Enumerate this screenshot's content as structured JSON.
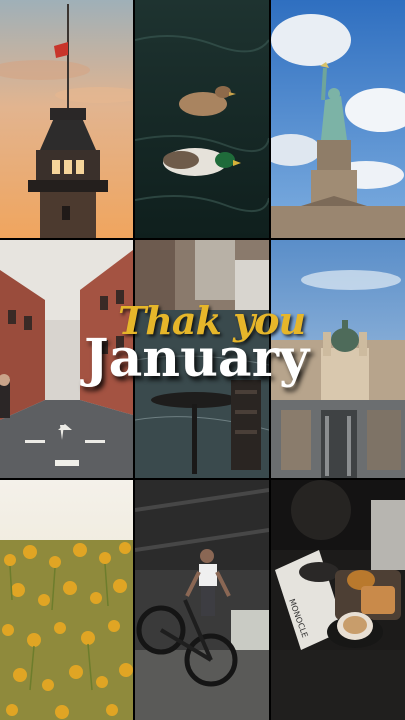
{
  "overlay": {
    "script_text": "Thak you",
    "main_text": "January"
  },
  "tiles": [
    {
      "name": "tower-sunset-photo"
    },
    {
      "name": "ducks-on-water-photo"
    },
    {
      "name": "statue-of-liberty-photo"
    },
    {
      "name": "city-street-photo"
    },
    {
      "name": "wet-cafe-table-photo"
    },
    {
      "name": "city-skyline-basilica-photo"
    },
    {
      "name": "yellow-flower-field-photo"
    },
    {
      "name": "bmx-rider-photo"
    },
    {
      "name": "coffee-magazine-photo"
    }
  ],
  "props": {
    "magazine_title": "MONOCLE"
  },
  "colors": {
    "script_gold": "#e6b62a",
    "main_white": "#ffffff"
  }
}
